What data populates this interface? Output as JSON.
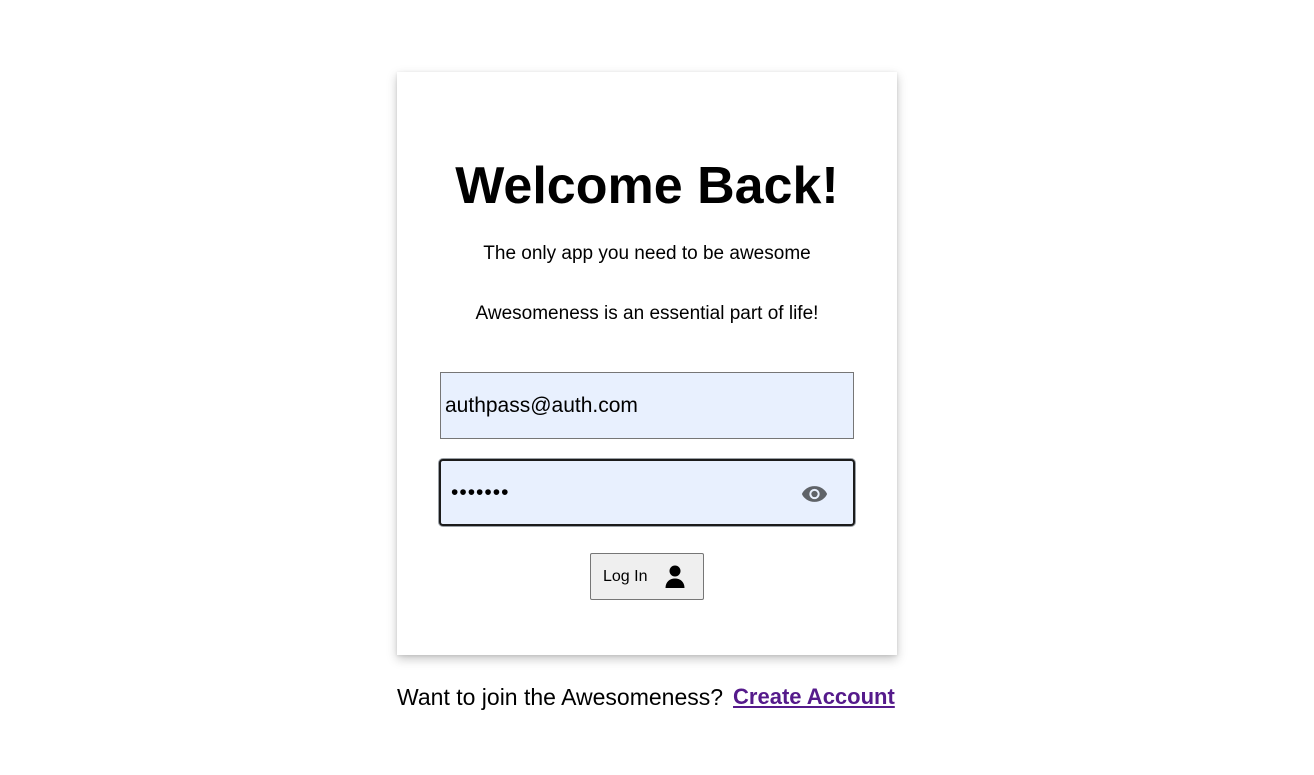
{
  "login_card": {
    "title": "Welcome Back!",
    "tagline": "The only app you need to be awesome",
    "description": "Awesomeness is an essential part of life!",
    "email": {
      "value": "authpass@auth.com",
      "placeholder": ""
    },
    "password": {
      "value": "•••••••",
      "toggle_icon": "eye-icon"
    },
    "login_button": {
      "label": "Log In",
      "icon": "user-icon"
    }
  },
  "footer": {
    "prompt": "Want to join the Awesomeness?",
    "link_label": "Create Account"
  },
  "colors": {
    "input_background": "#e8f0fe",
    "link": "#551a8b",
    "button_background": "#efefef"
  }
}
